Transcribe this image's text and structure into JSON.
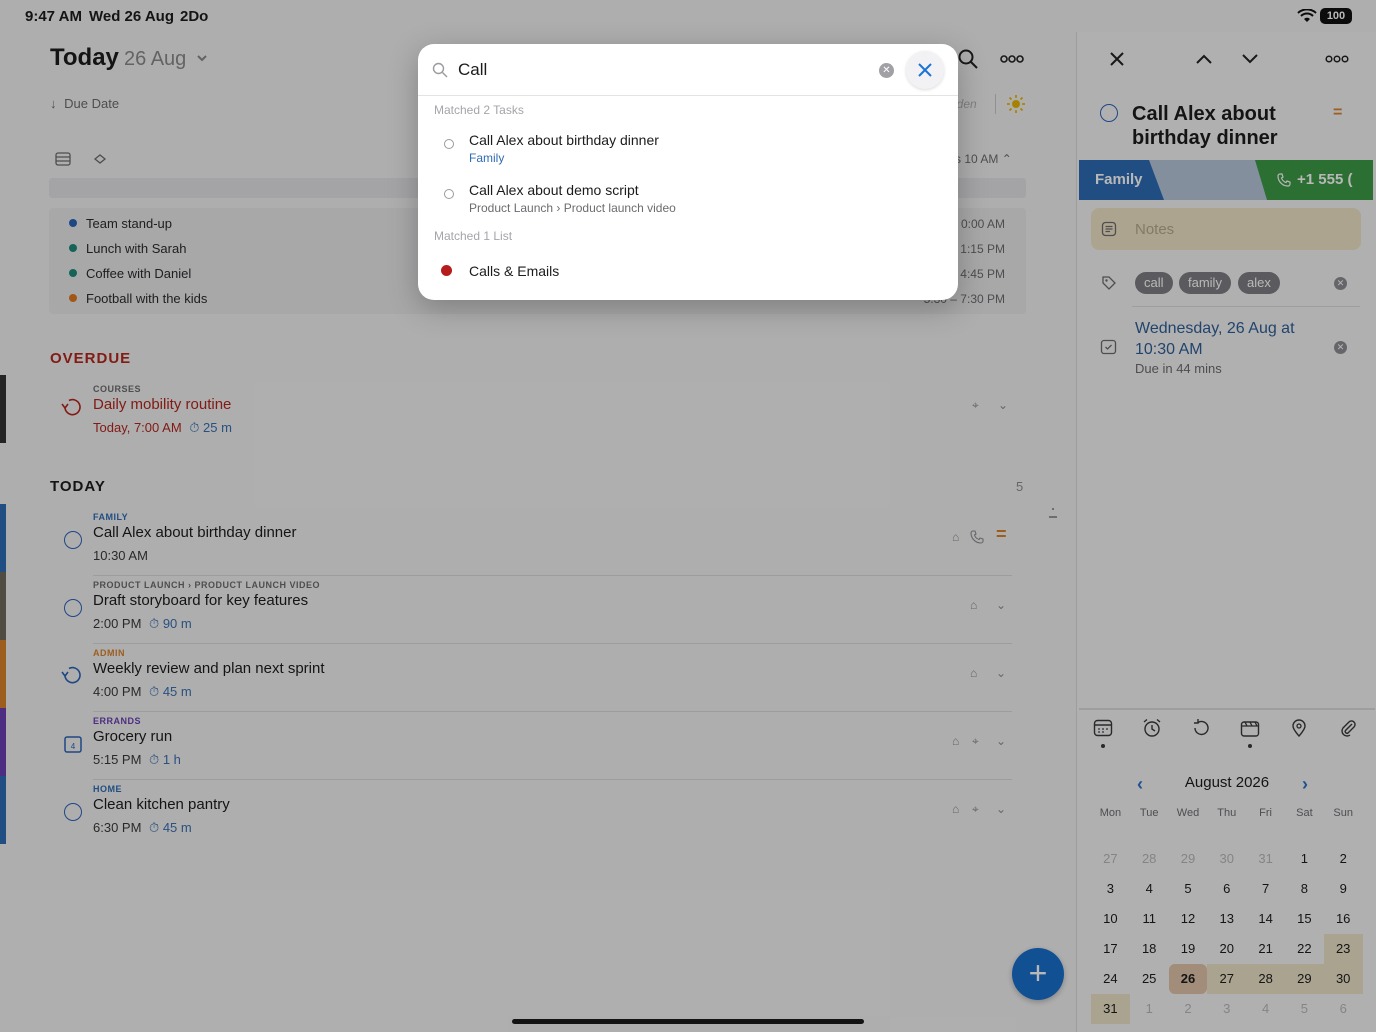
{
  "status_bar": {
    "time": "9:47 AM",
    "date": "Wed 26 Aug",
    "app": "2Do",
    "battery": "100"
  },
  "header": {
    "title": "Today",
    "date": "26 Aug",
    "sort_label": "Due Date",
    "hidden_label": "dden"
  },
  "timeline": {
    "end_label": "s 10 AM",
    "events": [
      {
        "name": "Team stand-up",
        "time": "0:00 AM",
        "color": "#2c63b8"
      },
      {
        "name": "Lunch with Sarah",
        "time": "1:15 PM",
        "color": "#1f8a7a"
      },
      {
        "name": "Coffee with Daniel",
        "time": "4:45 PM",
        "color": "#1f8a7a"
      },
      {
        "name": "Football with the kids",
        "time": "5:30 – 7:30 PM",
        "color": "#e07b1f"
      }
    ]
  },
  "overdue": {
    "heading": "OVERDUE",
    "task": {
      "category": "COURSES",
      "title": "Daily mobility routine",
      "time": "Today, 7:00 AM",
      "duration": "25 m"
    }
  },
  "today": {
    "heading": "TODAY",
    "count": "5",
    "tasks": [
      {
        "category": "FAMILY",
        "title": "Call Alex about birthday dinner",
        "time": "10:30 AM",
        "duration": "",
        "cat_color": "#2f6db4"
      },
      {
        "category": "PRODUCT LAUNCH › PRODUCT LAUNCH VIDEO",
        "title": "Draft storyboard for key features",
        "time": "2:00 PM",
        "duration": "90 m",
        "cat_color": "#6c6c70"
      },
      {
        "category": "ADMIN",
        "title": "Weekly review and plan next sprint",
        "time": "4:00 PM",
        "duration": "45 m",
        "cat_color": "#d9822b"
      },
      {
        "category": "ERRANDS",
        "title": "Grocery run",
        "time": "5:15 PM",
        "duration": "1 h",
        "cat_color": "#6a3fb5"
      },
      {
        "category": "HOME",
        "title": "Clean kitchen pantry",
        "time": "6:30 PM",
        "duration": "45 m",
        "cat_color": "#2f6db4"
      }
    ]
  },
  "detail": {
    "title": "Call Alex about birthday dinner",
    "priority": "=",
    "list_tag": "Family",
    "phone": "+1 555 (",
    "notes_placeholder": "Notes",
    "tags": [
      "call",
      "family",
      "alex"
    ],
    "due": "Wednesday, 26 Aug at 10:30 AM",
    "due_relative": "Due in 44 mins",
    "calendar": {
      "month": "August 2026",
      "weekdays": [
        "Mon",
        "Tue",
        "Wed",
        "Thu",
        "Fri",
        "Sat",
        "Sun"
      ],
      "weeks": [
        [
          "27",
          "28",
          "29",
          "30",
          "31",
          "1",
          "2"
        ],
        [
          "3",
          "4",
          "5",
          "6",
          "7",
          "8",
          "9"
        ],
        [
          "10",
          "11",
          "12",
          "13",
          "14",
          "15",
          "16"
        ],
        [
          "17",
          "18",
          "19",
          "20",
          "21",
          "22",
          "23"
        ],
        [
          "24",
          "25",
          "26",
          "27",
          "28",
          "29",
          "30"
        ],
        [
          "31",
          "1",
          "2",
          "3",
          "4",
          "5",
          "6"
        ]
      ],
      "today": "26"
    }
  },
  "search": {
    "query": "Call",
    "tasks_heading": "Matched 2 Tasks",
    "task_results": [
      {
        "title": "Call Alex about birthday dinner",
        "subtitle": "Family",
        "sub_color": "#2f6db4"
      },
      {
        "title": "Call Alex about demo script",
        "subtitle": "Product Launch › Product launch video",
        "sub_color": "#6c6c70"
      }
    ],
    "lists_heading": "Matched 1 List",
    "list_results": [
      {
        "title": "Calls & Emails",
        "color": "#b71c1c"
      }
    ]
  }
}
